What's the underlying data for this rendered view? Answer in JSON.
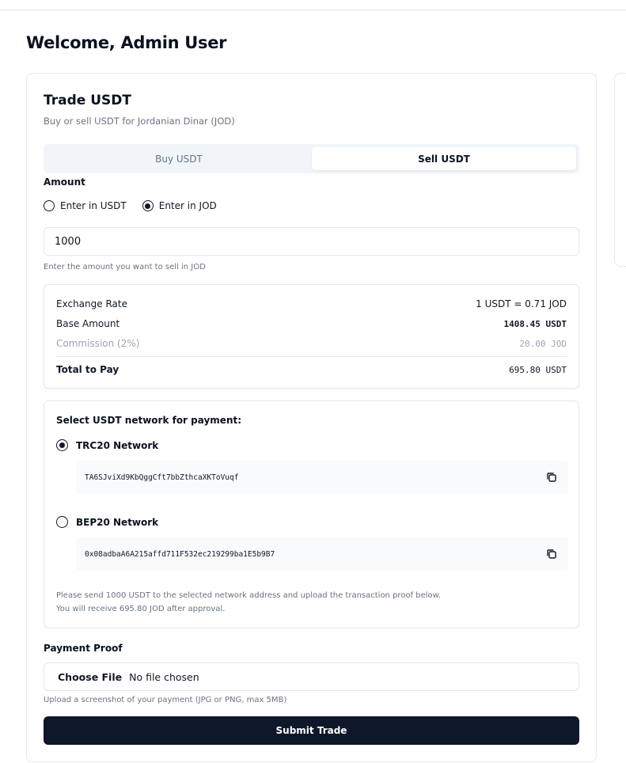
{
  "header": {
    "welcome": "Welcome, Admin User"
  },
  "trade": {
    "title": "Trade USDT",
    "subtitle": "Buy or sell USDT for Jordanian Dinar (JOD)",
    "tabs": [
      {
        "label": "Buy USDT",
        "active": false
      },
      {
        "label": "Sell USDT",
        "active": true
      }
    ],
    "amount": {
      "label": "Amount",
      "options": [
        {
          "label": "Enter in USDT",
          "selected": false
        },
        {
          "label": "Enter in JOD",
          "selected": true
        }
      ],
      "value": "1000",
      "hint": "Enter the amount you want to sell in JOD"
    },
    "summary": {
      "exchange_rate_label": "Exchange Rate",
      "exchange_rate_value": "1 USDT = 0.71 JOD",
      "base_amount_label": "Base Amount",
      "base_amount_value": "1408.45 USDT",
      "commission_label": "Commission (2%)",
      "commission_value": "20.00 JOD",
      "total_label": "Total to Pay",
      "total_value": "695.80 USDT"
    },
    "network": {
      "title": "Select USDT network for payment:",
      "options": [
        {
          "name": "TRC20 Network",
          "selected": true,
          "address": "TA6SJviXd9KbQggCft7bbZthcaXKToVuqf"
        },
        {
          "name": "BEP20 Network",
          "selected": false,
          "address": "0x08adbaA6A215affd711F532ec219299ba1E5b9B7"
        }
      ],
      "note_line1": "Please send 1000 USDT to the selected network address and upload the transaction proof below.",
      "note_line2": "You will receive 695.80 JOD after approval."
    },
    "payment_proof": {
      "label": "Payment Proof",
      "button": "Choose File",
      "status": "No file chosen",
      "hint": "Upload a screenshot of your payment (JPG or PNG, max 5MB)"
    },
    "submit_label": "Submit Trade"
  },
  "icons": {
    "copy": "copy-icon"
  },
  "colors": {
    "primary": "#0f172a",
    "tab_bg": "#f1f5f9",
    "muted_text": "#6b7280"
  }
}
